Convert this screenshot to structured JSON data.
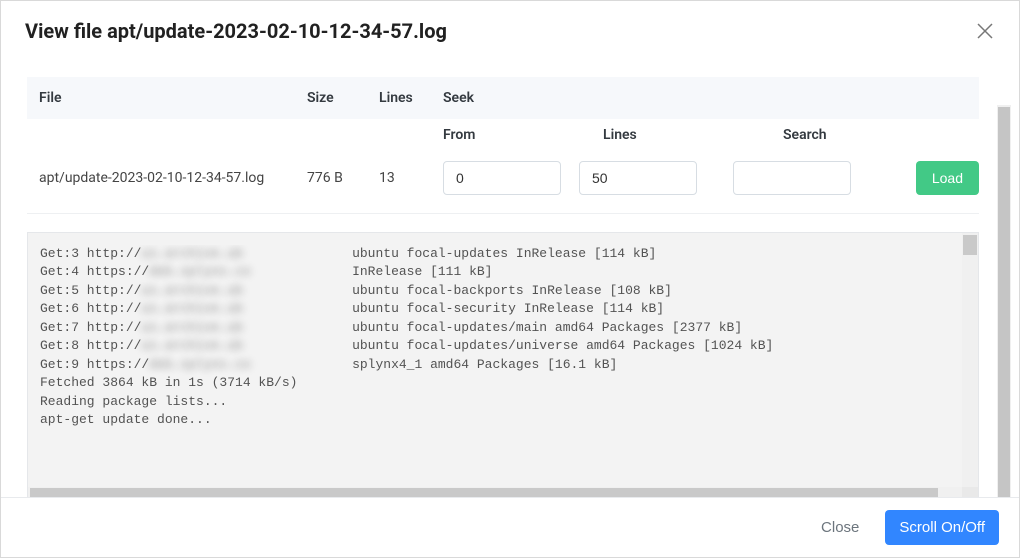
{
  "modal": {
    "title": "View file apt/update-2023-02-10-12-34-57.log",
    "close_icon": "close"
  },
  "table": {
    "headers": {
      "file": "File",
      "size": "Size",
      "lines": "Lines",
      "seek": "Seek"
    },
    "seek_headers": {
      "from": "From",
      "lines": "Lines",
      "search": "Search"
    },
    "row": {
      "file": "apt/update-2023-02-10-12-34-57.log",
      "size": "776 B",
      "lines": "13"
    },
    "inputs": {
      "from": "0",
      "lines": "50",
      "search": ""
    },
    "load_label": "Load"
  },
  "log": {
    "lines": [
      {
        "prefix": "Get:3 http://",
        "blur": "us.archive.ub",
        "suffix": "ubuntu focal-updates InRelease [114 kB]"
      },
      {
        "prefix": "Get:4 https://",
        "blur": "deb.splynx.co",
        "suffix": "InRelease [111 kB]"
      },
      {
        "prefix": "Get:5 http://",
        "blur": "us.archive.ub",
        "suffix": "ubuntu focal-backports InRelease [108 kB]"
      },
      {
        "prefix": "Get:6 http://",
        "blur": "us.archive.ub",
        "suffix": "ubuntu focal-security InRelease [114 kB]"
      },
      {
        "prefix": "Get:7 http://",
        "blur": "us.archive.ub",
        "suffix": "ubuntu focal-updates/main amd64 Packages [2377 kB]"
      },
      {
        "prefix": "Get:8 http://",
        "blur": "us.archive.ub",
        "suffix": "ubuntu focal-updates/universe amd64 Packages [1024 kB]"
      },
      {
        "prefix": "Get:9 https://",
        "blur": "deb.splynx.co",
        "suffix": "splynx4_1 amd64 Packages [16.1 kB]"
      },
      {
        "prefix": "Fetched 3864 kB in 1s (3714 kB/s)",
        "blur": "",
        "suffix": ""
      },
      {
        "prefix": "Reading package lists...",
        "blur": "",
        "suffix": ""
      },
      {
        "prefix": "apt-get update done...",
        "blur": "",
        "suffix": ""
      }
    ]
  },
  "footer": {
    "close_label": "Close",
    "scroll_label": "Scroll On/Off"
  }
}
